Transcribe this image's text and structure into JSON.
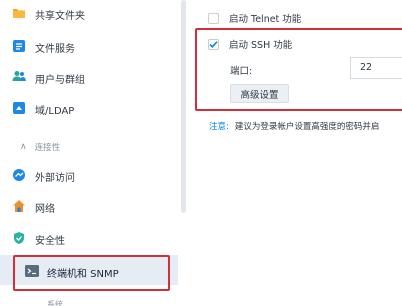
{
  "sidebar": {
    "items": [
      {
        "label": "共享文件夹",
        "icon": "shared-folder-icon",
        "color": "#f5a623"
      },
      {
        "label": "文件服务",
        "icon": "file-services-icon",
        "color": "#1e88e5"
      },
      {
        "label": "用户与群组",
        "icon": "user-group-icon",
        "color": "#26a69a"
      },
      {
        "label": "域/LDAP",
        "icon": "domain-ldap-icon",
        "color": "#1e88e5"
      }
    ],
    "section_label": "连接性",
    "connectivity_items": [
      {
        "label": "外部访问",
        "icon": "external-access-icon",
        "color": "#1e88e5"
      },
      {
        "label": "网络",
        "icon": "network-icon",
        "color": "#e8912d"
      },
      {
        "label": "安全性",
        "icon": "security-shield-icon",
        "color": "#26b3a0"
      },
      {
        "label": "终端机和 SNMP",
        "icon": "terminal-icon",
        "color": "#5a6b7c"
      }
    ],
    "partial_item": "系统"
  },
  "panel": {
    "telnet_label": "启动 Telnet 功能",
    "telnet_checked": false,
    "ssh_label": "启动 SSH 功能",
    "ssh_checked": true,
    "port_label": "端口:",
    "port_value": "22",
    "advanced_button": "高级设置",
    "note_key": "注意:",
    "note_text": "建议为登录帐户设置高强度的密码并启"
  },
  "colors": {
    "accent": "#0086e5",
    "highlight": "#d32f3b",
    "active_bg": "#e6ecf4"
  }
}
